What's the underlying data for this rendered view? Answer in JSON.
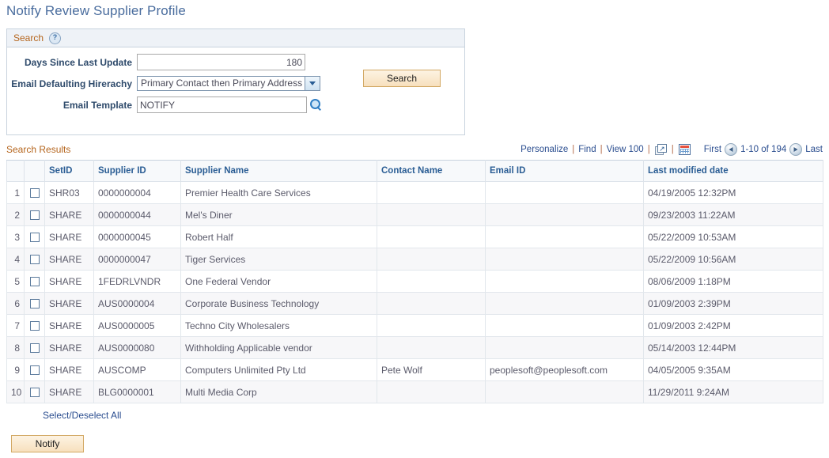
{
  "page": {
    "title": "Notify Review Supplier Profile"
  },
  "search_panel": {
    "header_label": "Search",
    "help_icon": "help-question-icon",
    "fields": {
      "days_label": "Days Since Last Update",
      "days_value": "180",
      "hierarchy_label": "Email Defaulting Hirerachy",
      "hierarchy_value": "Primary Contact then Primary Address",
      "template_label": "Email Template",
      "template_value": "NOTIFY",
      "lookup_icon": "magnifying-glass-icon"
    },
    "search_button": "Search"
  },
  "results": {
    "title": "Search Results",
    "tools": {
      "personalize": "Personalize",
      "find": "Find",
      "view": "View 100",
      "expand_icon": "expand-window-icon",
      "grid_icon": "download-spreadsheet-icon"
    },
    "pager": {
      "first": "First",
      "range": "1-10 of 194",
      "last": "Last",
      "prev_icon": "previous-page-icon",
      "next_icon": "next-page-icon"
    },
    "columns": [
      "",
      "",
      "SetID",
      "Supplier ID",
      "Supplier Name",
      "Contact Name",
      "Email ID",
      "Last modified date"
    ],
    "rows": [
      {
        "num": "1",
        "setid": "SHR03",
        "supplier_id": "0000000004",
        "supplier_name": "Premier Health Care Services",
        "contact_name": "",
        "email_id": "",
        "modified": "04/19/2005 12:32PM"
      },
      {
        "num": "2",
        "setid": "SHARE",
        "supplier_id": "0000000044",
        "supplier_name": "Mel's Diner",
        "contact_name": "",
        "email_id": "",
        "modified": "09/23/2003 11:22AM"
      },
      {
        "num": "3",
        "setid": "SHARE",
        "supplier_id": "0000000045",
        "supplier_name": "Robert Half",
        "contact_name": "",
        "email_id": "",
        "modified": "05/22/2009 10:53AM"
      },
      {
        "num": "4",
        "setid": "SHARE",
        "supplier_id": "0000000047",
        "supplier_name": "Tiger Services",
        "contact_name": "",
        "email_id": "",
        "modified": "05/22/2009 10:56AM"
      },
      {
        "num": "5",
        "setid": "SHARE",
        "supplier_id": "1FEDRLVNDR",
        "supplier_name": "One Federal Vendor",
        "contact_name": "",
        "email_id": "",
        "modified": "08/06/2009  1:18PM"
      },
      {
        "num": "6",
        "setid": "SHARE",
        "supplier_id": "AUS0000004",
        "supplier_name": "Corporate Business Technology",
        "contact_name": "",
        "email_id": "",
        "modified": "01/09/2003  2:39PM"
      },
      {
        "num": "7",
        "setid": "SHARE",
        "supplier_id": "AUS0000005",
        "supplier_name": "Techno City Wholesalers",
        "contact_name": "",
        "email_id": "",
        "modified": "01/09/2003  2:42PM"
      },
      {
        "num": "8",
        "setid": "SHARE",
        "supplier_id": "AUS0000080",
        "supplier_name": "Withholding Applicable vendor",
        "contact_name": "",
        "email_id": "",
        "modified": "05/14/2003 12:44PM"
      },
      {
        "num": "9",
        "setid": "SHARE",
        "supplier_id": "AUSCOMP",
        "supplier_name": "Computers Unlimited Pty Ltd",
        "contact_name": "Pete Wolf",
        "email_id": "peoplesoft@peoplesoft.com",
        "modified": "04/05/2005  9:35AM"
      },
      {
        "num": "10",
        "setid": "SHARE",
        "supplier_id": "BLG0000001",
        "supplier_name": "Multi Media Corp",
        "contact_name": "",
        "email_id": "",
        "modified": "11/29/2011  9:24AM"
      }
    ],
    "select_all_link": "Select/Deselect All"
  },
  "footer": {
    "notify_button": "Notify"
  },
  "colors": {
    "title_blue": "#4a6d9e",
    "section_orange": "#b5651d",
    "link_blue": "#2a4d8f",
    "header_blue": "#2a5d94",
    "button_tan": "#d2a863"
  }
}
